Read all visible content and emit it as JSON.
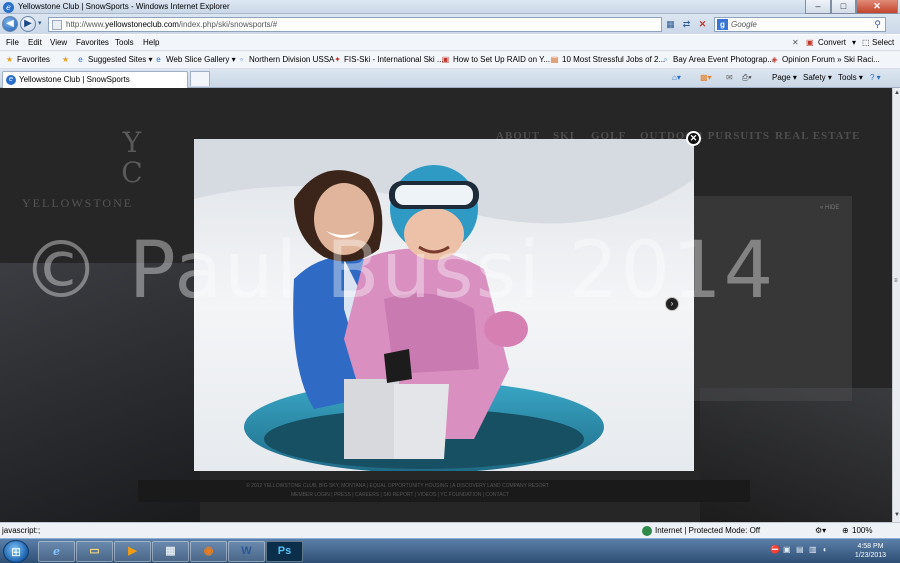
{
  "window": {
    "title": "Yellowstone Club | SnowSports - Windows Internet Explorer",
    "min": "–",
    "max": "□",
    "close": "✕"
  },
  "nav": {
    "url_prefix": "http://www.",
    "url_domain": "yellowstoneclub.com",
    "url_path": "/index.php/ski/snowsports/#",
    "search_placeholder": "Google"
  },
  "menu": {
    "items": [
      "File",
      "Edit",
      "View",
      "Favorites",
      "Tools",
      "Help"
    ],
    "convert": "Convert",
    "select": "Select"
  },
  "favorites": {
    "label": "Favorites",
    "items": [
      "Suggested Sites ▾",
      "Web Slice Gallery ▾",
      "Northern Division USSA",
      "FIS-Ski - International Ski ...",
      "How to Set Up RAID on Y...",
      "10 Most Stressful Jobs of 2...",
      "Bay Area Event Photograp...",
      "Opinion Forum » Ski Raci..."
    ]
  },
  "tabs": {
    "active": "Yellowstone Club | SnowSports"
  },
  "commandbar": {
    "page": "Page ▾",
    "safety": "Safety ▾",
    "tools": "Tools ▾",
    "help": "? ▾"
  },
  "site": {
    "logo_text": "YELLOWSTONE",
    "nav": [
      "ABOUT",
      "SKI",
      "GOLF",
      "OUTDOOR PURSUITS",
      "REAL ESTATE"
    ],
    "hide": "« HIDE",
    "footer_line1": "© 2012 YELLOWSTONE CLUB, BIG SKY, MONTANA   |   EQUAL OPPORTUNITY HOUSING   |   A DISCOVERY LAND COMPANY RESORT",
    "footer_line2": "MEMBER LOGIN   |   PRESS   |   CAREERS   |   SKI REPORT   |   VIDEOS   |   YC FOUNDATION   |   CONTACT"
  },
  "lightbox": {
    "watermark": "© Paul Bussi 2014",
    "close_glyph": "✕",
    "next_glyph": "›"
  },
  "status": {
    "text": "javascript:;",
    "zone": "Internet | Protected Mode: Off",
    "zoom": "100%"
  },
  "taskbar": {
    "apps": [
      "e",
      "▭",
      "▶",
      "▦",
      "◉",
      "W",
      "Ps"
    ],
    "time": "4:58 PM",
    "date": "1/23/2013"
  }
}
